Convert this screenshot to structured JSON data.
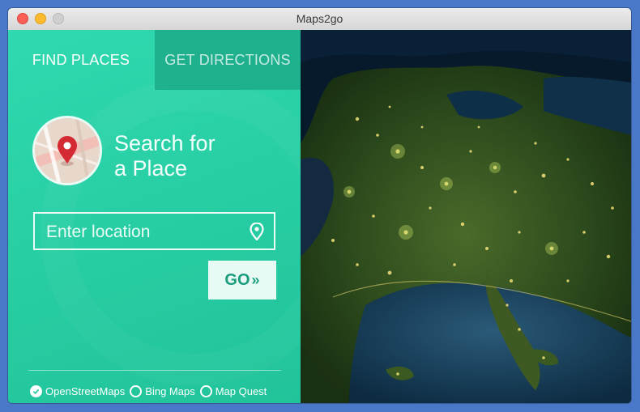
{
  "window": {
    "title": "Maps2go"
  },
  "tabs": [
    {
      "label": "FIND PLACES",
      "active": true
    },
    {
      "label": "GET DIRECTIONS",
      "active": false
    }
  ],
  "search": {
    "heading_line1": "Search for",
    "heading_line2": "a Place",
    "placeholder": "Enter location",
    "value": ""
  },
  "go_button": {
    "label": "GO",
    "icon": "double-chevron-right-icon"
  },
  "providers": [
    {
      "label": "OpenStreetMaps",
      "selected": true
    },
    {
      "label": "Bing Maps",
      "selected": false
    },
    {
      "label": "Map Quest",
      "selected": false
    }
  ],
  "colors": {
    "accent": "#2ad0a5",
    "tab_inactive_bg": "#1fb08d",
    "pin_red": "#d42a33",
    "go_text": "#1a9e7d"
  }
}
